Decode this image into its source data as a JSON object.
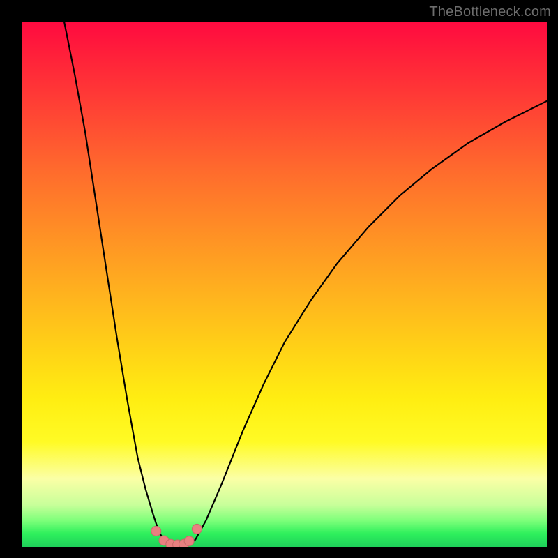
{
  "watermark": "TheBottleneck.com",
  "colors": {
    "curve_stroke": "#000000",
    "marker_fill": "#e98080",
    "marker_stroke": "#c86a6a",
    "gradient_top": "#ff0a40",
    "gradient_bottom": "#1fd15a",
    "page_bg": "#000000"
  },
  "chart_data": {
    "type": "line",
    "title": "",
    "xlabel": "",
    "ylabel": "",
    "xlim": [
      0,
      100
    ],
    "ylim": [
      0,
      100
    ],
    "grid": false,
    "legend": false,
    "notes": "V-shaped bottleneck curve on vertical red→green gradient. Values approximate curve height (100=top/red, 0=bottom/green) read from image because axes are unlabeled.",
    "series": [
      {
        "name": "left-branch",
        "x": [
          8,
          10,
          12,
          14,
          16,
          18,
          20,
          22,
          23.5,
          25,
          26,
          27,
          27.8
        ],
        "values": [
          100,
          90,
          79,
          66,
          53,
          40,
          28,
          17,
          11,
          6,
          3,
          1.2,
          0.4
        ]
      },
      {
        "name": "right-branch",
        "x": [
          31.8,
          33,
          35,
          38,
          42,
          46,
          50,
          55,
          60,
          66,
          72,
          78,
          85,
          92,
          100
        ],
        "values": [
          0.4,
          1.4,
          5,
          12,
          22,
          31,
          39,
          47,
          54,
          61,
          67,
          72,
          77,
          81,
          85
        ]
      }
    ],
    "markers": {
      "name": "bottom-cluster",
      "x": [
        25.5,
        27,
        28.3,
        29.6,
        30.8,
        31.8,
        33.3
      ],
      "values": [
        3.0,
        1.2,
        0.5,
        0.4,
        0.5,
        1.1,
        3.4
      ]
    }
  }
}
